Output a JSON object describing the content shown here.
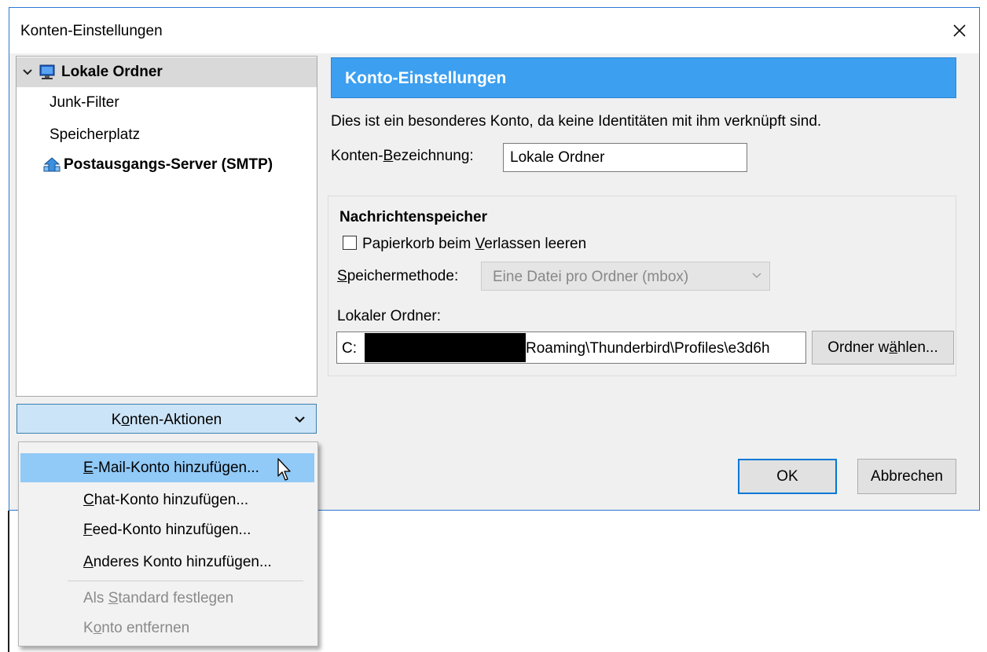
{
  "window": {
    "title": "Konten-Einstellungen",
    "close_label": "✕"
  },
  "tree": {
    "items": [
      {
        "label": "Lokale Ordner",
        "expanded": true,
        "selected": true,
        "icon": "monitor-icon"
      },
      {
        "label": "Junk-Filter"
      },
      {
        "label": "Speicherplatz"
      },
      {
        "label": "Postausgangs-Server (SMTP)",
        "icon": "network-icon"
      }
    ]
  },
  "actions": {
    "label_pre": "K",
    "label_u": "o",
    "label_post": "nten-Aktionen"
  },
  "panel": {
    "header": "Konto-Einstellungen",
    "description": "Dies ist ein besonderes Konto, da keine Identitäten mit ihm verknüpft sind.",
    "account_label_pre": "Konten-",
    "account_label_u": "B",
    "account_label_post": "ezeichnung:",
    "account_value": "Lokale Ordner",
    "storage": {
      "title": "Nachrichtenspeicher",
      "empty_trash_pre": "Papierkorb beim ",
      "empty_trash_u": "V",
      "empty_trash_post": "erlassen leeren",
      "empty_trash_checked": false,
      "method_label_u": "S",
      "method_label_post": "peichermethode:",
      "method_value": "Eine Datei pro Ordner (mbox)",
      "local_folder_label": "Lokaler Ordner:",
      "path_prefix": "C:",
      "path_suffix": "Roaming\\Thunderbird\\Profiles\\e3d6h",
      "choose_pre": "Ordner w",
      "choose_u": "ä",
      "choose_post": "hlen..."
    }
  },
  "buttons": {
    "ok": "OK",
    "cancel": "Abbrechen"
  },
  "menu": {
    "items": [
      {
        "u": "E",
        "rest": "-Mail-Konto hinzufügen...",
        "highlighted": true
      },
      {
        "u": "C",
        "rest": "hat-Konto hinzufügen..."
      },
      {
        "u": "F",
        "rest": "eed-Konto hinzufügen..."
      },
      {
        "u": "A",
        "rest": "nderes Konto hinzufügen..."
      }
    ],
    "disabled_items": [
      {
        "pre": "Als ",
        "u": "S",
        "rest": "tandard festlegen"
      },
      {
        "pre": "K",
        "u": "o",
        "rest": "nto entfernen"
      }
    ]
  },
  "colors": {
    "accent": "#3c9ff0",
    "highlight": "#91c9f7",
    "action_button": "#cce4f7"
  }
}
